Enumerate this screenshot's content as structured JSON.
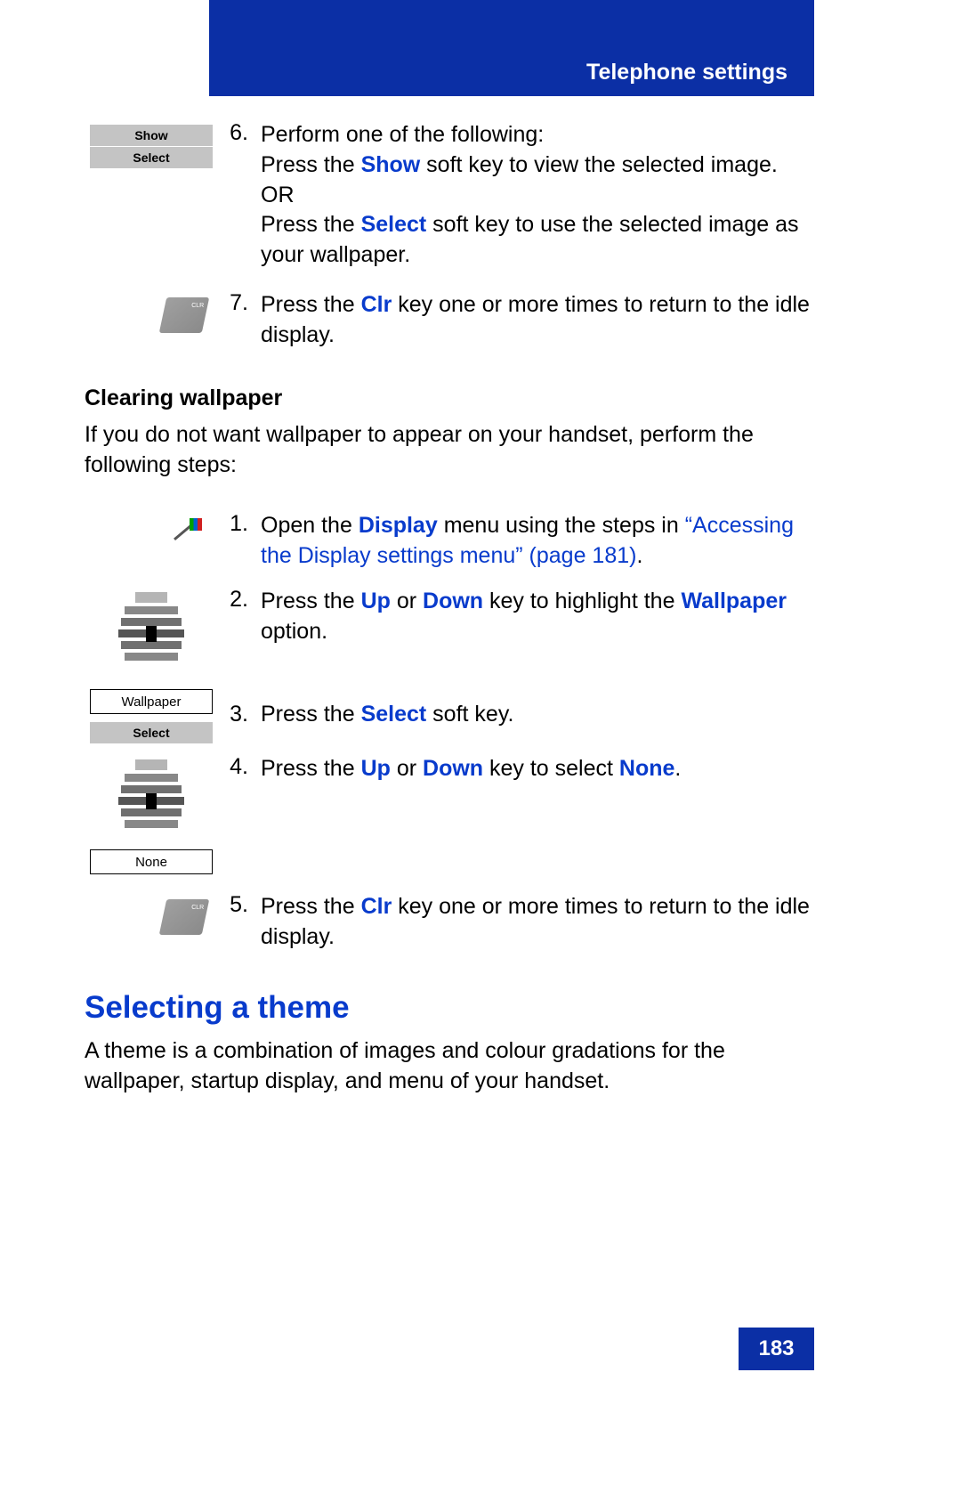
{
  "header": {
    "title": "Telephone settings"
  },
  "page_number": "183",
  "softkeys": {
    "show": "Show",
    "select": "Select",
    "wallpaper": "Wallpaper",
    "none": "None"
  },
  "step6": {
    "num": "6.",
    "line1": "Perform one of the following:",
    "line2a": "Press the ",
    "line2b": "Show",
    "line2c": " soft key to view the selected image.",
    "or": "OR",
    "line3a": "Press the ",
    "line3b": "Select",
    "line3c": " soft key to use the selected image as your wallpaper."
  },
  "step7": {
    "num": "7.",
    "a": "Press the ",
    "b": "Clr",
    "c": " key one or more times to return to the idle display."
  },
  "clearing": {
    "heading": "Clearing wallpaper",
    "intro": "If you do not want wallpaper to appear on your handset, perform the following steps:"
  },
  "c1": {
    "num": "1.",
    "a": "Open the ",
    "b": "Display",
    "c": " menu using the steps in ",
    "link": "“Accessing the Display settings menu” (page 181)",
    "dot": "."
  },
  "c2": {
    "num": "2.",
    "a": "Press the ",
    "b": "Up",
    "c": " or ",
    "d": "Down",
    "e": " key to highlight the ",
    "f": "Wallpaper",
    "g": " option."
  },
  "c3": {
    "num": "3.",
    "a": "Press the ",
    "b": "Select",
    "c": " soft key."
  },
  "c4": {
    "num": "4.",
    "a": "Press the ",
    "b": "Up",
    "c": " or ",
    "d": "Down",
    "e": " key to select ",
    "f": "None",
    "g": "."
  },
  "c5": {
    "num": "5.",
    "a": "Press the ",
    "b": "Clr",
    "c": " key one or more times to return to the idle display."
  },
  "theme": {
    "heading": "Selecting a theme",
    "body": "A theme is a combination of images and colour gradations for the wallpaper, startup display, and menu of your handset."
  }
}
